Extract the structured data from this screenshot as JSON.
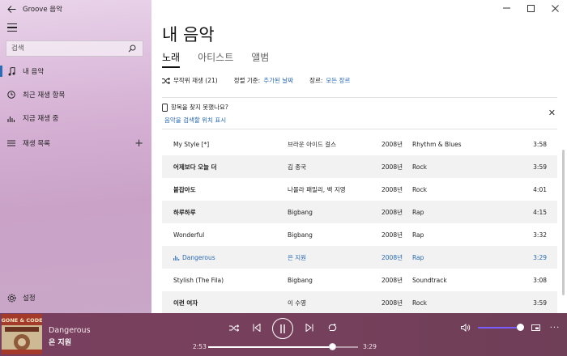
{
  "app": {
    "title": "Groove 음악"
  },
  "sidebar": {
    "search_placeholder": "검색",
    "items": [
      {
        "label": "내 음악",
        "icon": "music-note-icon",
        "active": true
      },
      {
        "label": "최근 재생 항목",
        "icon": "clock-icon",
        "active": false
      },
      {
        "label": "지금 재생 중",
        "icon": "equalizer-icon",
        "active": false
      },
      {
        "label": "재생 목록",
        "icon": "playlist-icon",
        "active": false
      }
    ],
    "settings_label": "설정"
  },
  "main": {
    "title": "내 음악",
    "tabs": [
      {
        "label": "노래",
        "active": true
      },
      {
        "label": "아티스트",
        "active": false
      },
      {
        "label": "앨범",
        "active": false
      }
    ],
    "toolbar": {
      "shuffle_label": "무작위 재생 (21)",
      "sort_label": "정렬 기준:",
      "sort_value": "추가된 날짜",
      "genre_label": "장르:",
      "genre_value": "모든 장르"
    },
    "info": {
      "question": "항목을 찾지 못했나요?",
      "link": "음악을 검색할 위치 표시"
    },
    "songs": [
      {
        "title": "My Style [*]",
        "artist": "브라운 아이드 걸스",
        "year": "2008년",
        "genre": "Rhythm & Blues",
        "duration": "3:58",
        "playing": false
      },
      {
        "title": "어제보다 오늘 더",
        "artist": "김 종국",
        "year": "2008년",
        "genre": "Rock",
        "duration": "3:59",
        "playing": false
      },
      {
        "title": "붙잡아도",
        "artist": "나몰라 패밀리, 백 지영",
        "year": "2008년",
        "genre": "Rock",
        "duration": "4:01",
        "playing": false
      },
      {
        "title": "하루하루",
        "artist": "Bigbang",
        "year": "2008년",
        "genre": "Rap",
        "duration": "4:15",
        "playing": false
      },
      {
        "title": "Wonderful",
        "artist": "Bigbang",
        "year": "2008년",
        "genre": "Rap",
        "duration": "3:32",
        "playing": false
      },
      {
        "title": "Dangerous",
        "artist": "은 지원",
        "year": "2008년",
        "genre": "Rap",
        "duration": "3:29",
        "playing": true
      },
      {
        "title": "Stylish (The Fila)",
        "artist": "Bigbang",
        "year": "2008년",
        "genre": "Soundtrack",
        "duration": "3:08",
        "playing": false
      },
      {
        "title": "이런 여자",
        "artist": "이 수영",
        "year": "2008년",
        "genre": "Rock",
        "duration": "3:59",
        "playing": false
      }
    ]
  },
  "player": {
    "title": "Dangerous",
    "artist": "은 지원",
    "elapsed": "2:53",
    "total": "3:29",
    "progress": 0.83,
    "volume": 1.0,
    "album_art_text": "GONE & CODE"
  },
  "colors": {
    "accent": "#2768b5",
    "player_bg": "#76405c"
  }
}
